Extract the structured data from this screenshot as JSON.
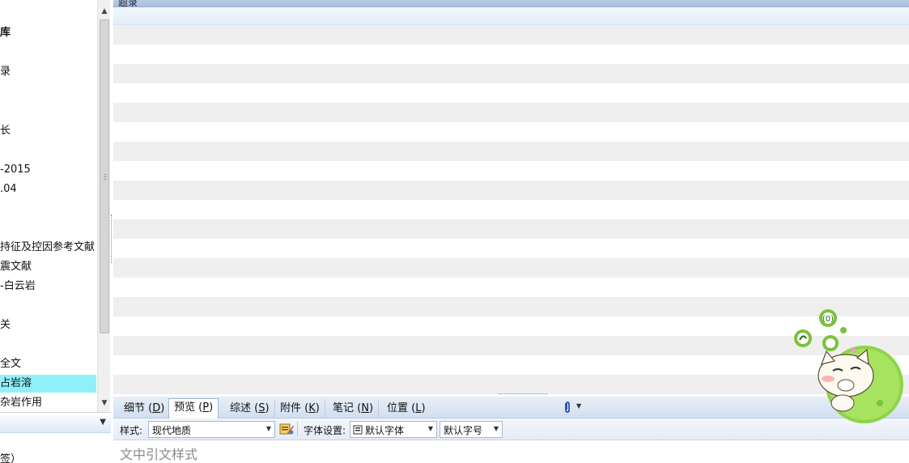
{
  "sidebar": {
    "items": [
      {
        "label": "库",
        "bold": true
      },
      {
        "label": "录"
      },
      {
        "label": "长"
      },
      {
        "label": "-2015"
      },
      {
        "label": ".04"
      },
      {
        "label": "持征及控因参考文献"
      },
      {
        "label": "震文献"
      },
      {
        "label": "-白云岩"
      },
      {
        "label": "关"
      },
      {
        "label": "全文"
      },
      {
        "label": "占岩溶",
        "selected": true
      },
      {
        "label": "杂岩作用"
      }
    ],
    "bottom_text": "签）"
  },
  "main": {
    "column_header": "题录"
  },
  "tabs": [
    {
      "label": "细节 (",
      "key": "D",
      "end": ")"
    },
    {
      "label": "预览 (",
      "key": "P",
      "end": ")",
      "active": true
    },
    {
      "label": "综述 (",
      "key": "S",
      "end": ")"
    },
    {
      "label": "附件 (",
      "key": "K",
      "end": ")"
    },
    {
      "label": "笔记 (",
      "key": "N",
      "end": ")"
    },
    {
      "label": "位置 (",
      "key": "L",
      "end": ")"
    }
  ],
  "toolbar": {
    "style_label": "样式:",
    "style_value": "现代地质",
    "font_label": "字体设置:",
    "font_value": "默认字体",
    "size_value": "默认字号"
  },
  "preview": {
    "placeholder": "文中引文样式",
    "sub": "…"
  },
  "colors": {
    "selected_row": "#8ff0f8",
    "alt_row": "#efefef",
    "header_blue": "#b8cce4"
  }
}
